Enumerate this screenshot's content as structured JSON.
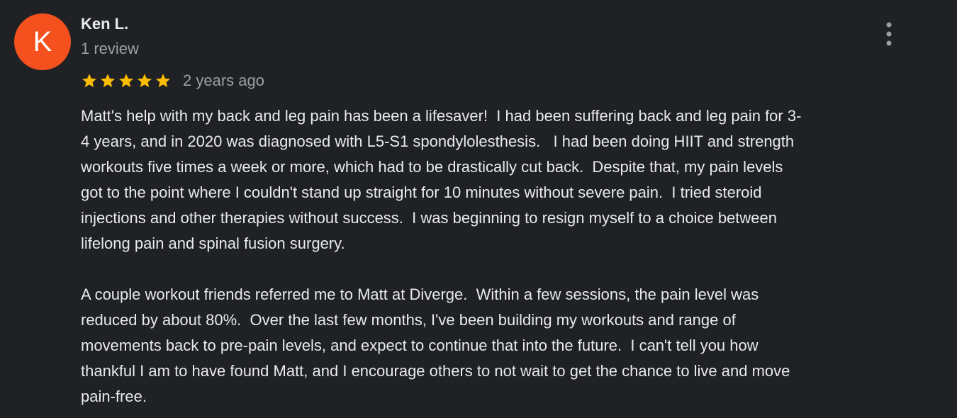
{
  "reviewer": {
    "initial": "K",
    "name": "Ken L.",
    "review_count": "1 review",
    "avatar_color": "#f4511e"
  },
  "rating": {
    "stars": 5,
    "max": 5,
    "star_color": "#fbbc04",
    "date": "2 years ago"
  },
  "menu": {
    "icon": "more-vert-icon"
  },
  "review": {
    "line1": "Matt's help with my back and leg pain has been a lifesaver!  I had been suffering back and leg pain for 3-",
    "line2": "4 years, and in 2020 was diagnosed with L5-S1 spondylolesthesis.   I had been doing HIIT and strength",
    "line3": "workouts five times a week or more, which had to be drastically cut back.  Despite that, my pain levels",
    "line4": "got to the point where I couldn't stand up straight for 10 minutes without severe pain.  I tried steroid",
    "line5": "injections and other therapies without success.  I was beginning to resign myself to a choice between",
    "line6": "lifelong pain and spinal fusion surgery.",
    "line7": "A couple workout friends referred me to Matt at Diverge.  Within a few sessions, the pain level was",
    "line8": "reduced by about 80%.  Over the last few months, I've been building my workouts and range of",
    "line9": "movements back to pre-pain levels, and expect to continue that into the future.  I can't tell you how",
    "line10": "thankful I am to have found Matt, and I encourage others to not wait to get the chance to live and move",
    "line11": "pain-free."
  }
}
